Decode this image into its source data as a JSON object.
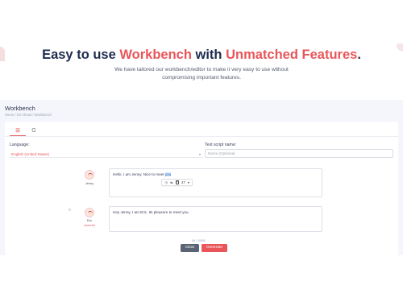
{
  "hero": {
    "title_part1": "Easy to use ",
    "title_accent1": "Workbench",
    "title_part2": " with ",
    "title_accent2": "Unmatched Features",
    "title_dot": ".",
    "subtitle": "We have tailored our workbench/editor to make it very easy to use without compromising important features."
  },
  "app": {
    "title": "Workbench",
    "breadcrumb": "Home  /  Go Ahead  /  Workbench",
    "tabs": [
      {
        "icon": "grid-icon",
        "glyph": "⊞"
      },
      {
        "icon": "google-icon",
        "glyph": "G"
      }
    ],
    "language_label": "Language:",
    "language_value": "English (United States)",
    "script_name_label": "Text script name:",
    "script_name_placeholder": "Name (Optional)",
    "speakers": [
      {
        "name": "Jenny",
        "text_before": "Hello. I am Jenny. Nice to meet ",
        "text_highlight": "you"
      },
      {
        "name": "Eric",
        "voice_style": "cheerful",
        "text": "Hey Jenny, I am Eric. Its pleasure to meet you."
      }
    ],
    "toolbar": {
      "items": [
        "◷",
        "⇆",
        "P",
        "47",
        "▾"
      ]
    },
    "drag_handle": "⠿",
    "counter": "45 / 10000",
    "clear_label": "Clear",
    "generate_label": "Generate"
  },
  "colors": {
    "accent": "#e8565a",
    "navy": "#1f2c4f",
    "clear_button": "#5b6472"
  }
}
